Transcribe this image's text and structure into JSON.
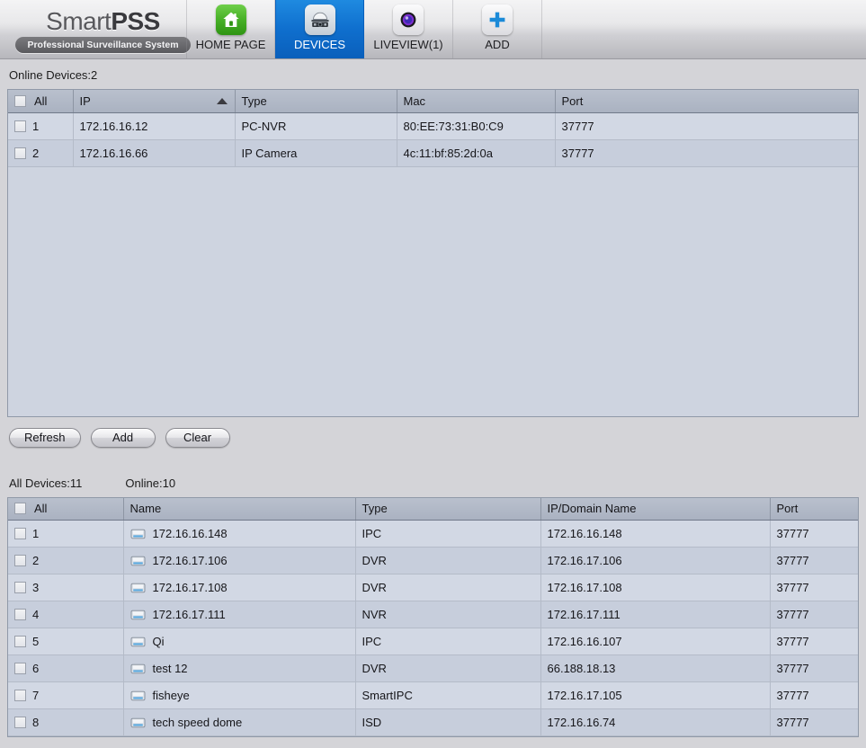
{
  "app": {
    "logo_main_light": "Smart",
    "logo_main_bold": "PSS",
    "logo_subtitle": "Professional Surveillance System",
    "accent_blue": "#0f6fce",
    "header_bg": "#e8e8ea"
  },
  "nav": {
    "tabs": [
      {
        "label": "HOME PAGE",
        "icon": "home-icon",
        "active": false
      },
      {
        "label": "DEVICES",
        "icon": "dome-camera-icon",
        "active": true
      },
      {
        "label": "LIVEVIEW(1)",
        "icon": "camera-lens-icon",
        "active": false
      },
      {
        "label": "ADD",
        "icon": "plus-icon",
        "active": false
      }
    ]
  },
  "online_section": {
    "status": "Online Devices:2",
    "columns": [
      "All",
      "IP",
      "Type",
      "Mac",
      "Port"
    ],
    "sorted_column": "IP",
    "sort_direction": "ascending",
    "select_all_label": "All",
    "rows": [
      {
        "num": "1",
        "ip": "172.16.16.12",
        "type": "PC-NVR",
        "mac": "80:EE:73:31:B0:C9",
        "port": "37777"
      },
      {
        "num": "2",
        "ip": "172.16.16.66",
        "type": "IP Camera",
        "mac": "4c:11:bf:85:2d:0a",
        "port": "37777"
      }
    ],
    "buttons": [
      {
        "label": "Refresh",
        "name": "refresh-button"
      },
      {
        "label": "Add",
        "name": "add-button"
      },
      {
        "label": "Clear",
        "name": "clear-button"
      }
    ]
  },
  "all_devices_section": {
    "status_total": "All Devices:11",
    "status_online": "Online:10",
    "columns": [
      "All",
      "Name",
      "Type",
      "IP/Domain Name",
      "Port"
    ],
    "select_all_label": "All",
    "rows": [
      {
        "num": "1",
        "name": "172.16.16.148",
        "type": "IPC",
        "ip": "172.16.16.148",
        "port": "37777"
      },
      {
        "num": "2",
        "name": "172.16.17.106",
        "type": "DVR",
        "ip": "172.16.17.106",
        "port": "37777"
      },
      {
        "num": "3",
        "name": "172.16.17.108",
        "type": "DVR",
        "ip": "172.16.17.108",
        "port": "37777"
      },
      {
        "num": "4",
        "name": "172.16.17.111",
        "type": "NVR",
        "ip": "172.16.17.111",
        "port": "37777"
      },
      {
        "num": "5",
        "name": "Qi",
        "type": "IPC",
        "ip": "172.16.16.107",
        "port": "37777"
      },
      {
        "num": "6",
        "name": "test 12",
        "type": "DVR",
        "ip": "66.188.18.13",
        "port": "37777"
      },
      {
        "num": "7",
        "name": "fisheye",
        "type": "SmartIPC",
        "ip": "172.16.17.105",
        "port": "37777"
      },
      {
        "num": "8",
        "name": "tech speed dome",
        "type": "ISD",
        "ip": "172.16.16.74",
        "port": "37777"
      }
    ]
  }
}
